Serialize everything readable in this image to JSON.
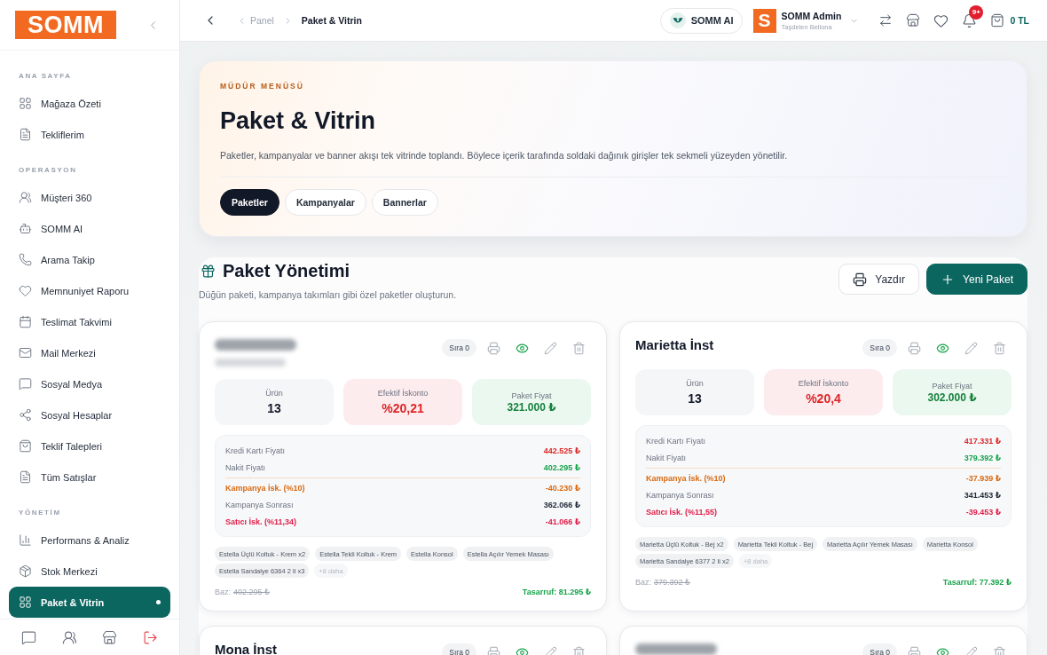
{
  "sidebar": {
    "logo": "SOMM",
    "sections": [
      {
        "title": "ANA SAYFA",
        "items": [
          {
            "label": "Mağaza Özeti",
            "selected": false
          },
          {
            "label": "Tekliflerim",
            "selected": false
          }
        ]
      },
      {
        "title": "OPERASYON",
        "items": [
          {
            "label": "Müşteri 360",
            "selected": false
          },
          {
            "label": "SOMM AI",
            "selected": false
          },
          {
            "label": "Arama Takip",
            "selected": false
          },
          {
            "label": "Memnuniyet Raporu",
            "selected": false
          },
          {
            "label": "Teslimat Takvimi",
            "selected": false
          },
          {
            "label": "Mail Merkezi",
            "selected": false
          },
          {
            "label": "Sosyal Medya",
            "selected": false
          },
          {
            "label": "Sosyal Hesaplar",
            "selected": false
          },
          {
            "label": "Teklif Talepleri",
            "selected": false
          },
          {
            "label": "Tüm Satışlar",
            "selected": false
          }
        ]
      },
      {
        "title": "YÖNETİM",
        "items": [
          {
            "label": "Performans & Analiz",
            "selected": false
          },
          {
            "label": "Stok Merkezi",
            "selected": false
          },
          {
            "label": "Paket & Vitrin",
            "selected": true
          }
        ]
      }
    ]
  },
  "topbar": {
    "breadcrumbs": [
      "Panel",
      "Paket & Vitrin"
    ],
    "ai_button": "SOMM AI",
    "user": {
      "avatar": "S",
      "name": "SOMM Admin",
      "store": "Taşdelen Bellona"
    },
    "notifications": "9+",
    "cart_total": "0 TL"
  },
  "hero": {
    "eyebrow": "MÜDÜR MENÜSÜ",
    "title": "Paket & Vitrin",
    "description": "Paketler, kampanyalar ve banner akışı tek vitrinde toplandı. Böylece içerik tarafında soldaki dağınık girişler tek sekmeli yüzeyden yönetilir.",
    "tabs": [
      {
        "label": "Paketler",
        "selected": true
      },
      {
        "label": "Kampanyalar",
        "selected": false
      },
      {
        "label": "Bannerlar",
        "selected": false
      }
    ]
  },
  "packages": {
    "title": "Paket Yönetimi",
    "subtitle": "Düğün paketi, kampanya takımları gibi özel paketler oluşturun.",
    "buttons": [
      {
        "label": "Yazdır",
        "kind": "secondary"
      },
      {
        "label": "Yeni Paket",
        "kind": "primary"
      }
    ],
    "cards": [
      {
        "redacted_title": true,
        "redacted_subtitle": true,
        "order": "Sıra 0",
        "visible": true,
        "stats": [
          {
            "label": "Ürün",
            "value": "13",
            "kind": "count"
          },
          {
            "label": "Efektif İskonto",
            "value": "%20,21",
            "kind": "discount"
          },
          {
            "label": "Paket Fiyat",
            "value": "321.000 ₺",
            "kind": "price"
          }
        ],
        "breakdown": [
          {
            "label": "Kredi Kartı Fiyatı",
            "value": "442.525 ₺",
            "kind": "credit"
          },
          {
            "label": "Nakit Fiyatı",
            "value": "402.295 ₺",
            "kind": "cash"
          },
          {
            "label": "Kampanya İsk. (%10)",
            "value": "-40.230 ₺",
            "kind": "campaign"
          },
          {
            "label": "Kampanya Sonrası",
            "value": "362.066 ₺",
            "kind": "net"
          },
          {
            "label": "Satıcı İsk. (%11,34)",
            "value": "-41.066 ₺",
            "kind": "seller"
          }
        ],
        "items": [
          "Estella Üçlü Koltuk - Krem x2",
          "Estella Tekli Koltuk - Krem",
          "Estella Konsol",
          "Estella Açılır Yemek Masası",
          "Estella Sandalye 6364 2 li x3"
        ],
        "more": "+8 daha",
        "base_label": "Baz:",
        "base_price": "402.295 ₺",
        "savings": "Tasarruf: 81.295 ₺"
      },
      {
        "title": "Marietta İnst",
        "order": "Sıra 0",
        "visible": true,
        "stats": [
          {
            "label": "Ürün",
            "value": "13",
            "kind": "count"
          },
          {
            "label": "Efektif İskonto",
            "value": "%20,4",
            "kind": "discount"
          },
          {
            "label": "Paket Fiyat",
            "value": "302.000 ₺",
            "kind": "price"
          }
        ],
        "breakdown": [
          {
            "label": "Kredi Kartı Fiyatı",
            "value": "417.331 ₺",
            "kind": "credit"
          },
          {
            "label": "Nakit Fiyatı",
            "value": "379.392 ₺",
            "kind": "cash"
          },
          {
            "label": "Kampanya İsk. (%10)",
            "value": "-37.939 ₺",
            "kind": "campaign"
          },
          {
            "label": "Kampanya Sonrası",
            "value": "341.453 ₺",
            "kind": "net"
          },
          {
            "label": "Satıcı İsk. (%11,55)",
            "value": "-39.453 ₺",
            "kind": "seller"
          }
        ],
        "items": [
          "Marietta Üçlü Koltuk - Bej x2",
          "Marietta Tekli Koltuk - Bej",
          "Marietta Açılır Yemek Masası",
          "Marietta Konsol",
          "Marietta Sandalye 6377 2 li x2"
        ],
        "more": "+8 daha",
        "base_label": "Baz:",
        "base_price": "379.392 ₺",
        "savings": "Tasarruf: 77.392 ₺"
      },
      {
        "title": "Mona İnst",
        "order": "Sıra 0",
        "visible": true
      },
      {
        "redacted_title": true,
        "order": "Sıra 0",
        "visible": true
      }
    ]
  }
}
